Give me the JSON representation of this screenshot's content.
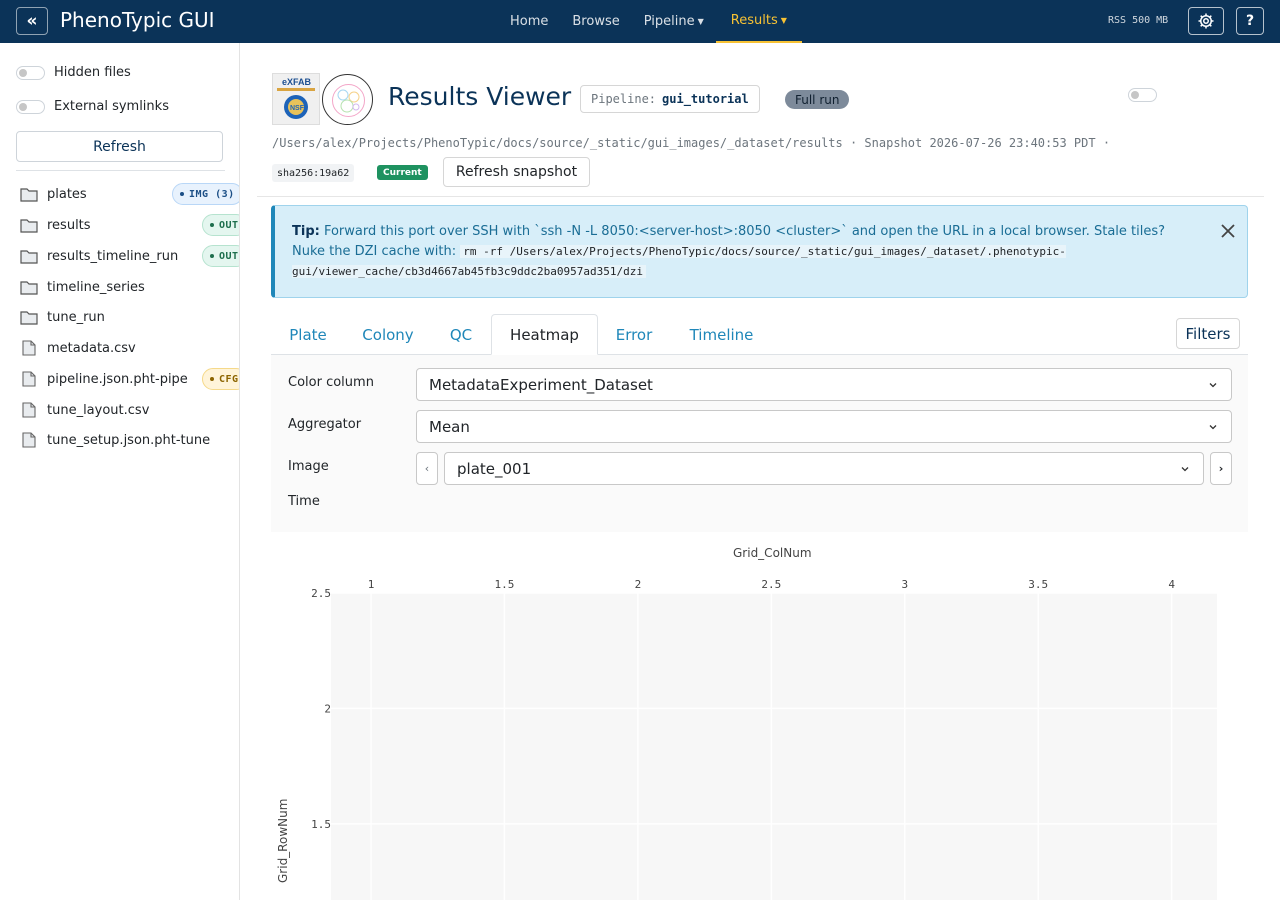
{
  "navbar": {
    "collapse_glyph": "«",
    "brand": "PhenoTypic GUI",
    "items": [
      {
        "label": "Home",
        "dropdown": false,
        "active": false
      },
      {
        "label": "Browse",
        "dropdown": false,
        "active": false
      },
      {
        "label": "Pipeline",
        "dropdown": true,
        "active": false
      },
      {
        "label": "Results",
        "dropdown": true,
        "active": true
      }
    ],
    "rss": "RSS 500 MB",
    "settings_icon": "gear-icon",
    "help_label": "?",
    "accent_color": "#f7c234",
    "bg_color": "#0b3358"
  },
  "sidebar": {
    "toggles": [
      {
        "label": "Hidden files",
        "on": false
      },
      {
        "label": "External symlinks",
        "on": false
      }
    ],
    "refresh_label": "Refresh",
    "items": [
      {
        "name": "plates",
        "type": "folder",
        "badge": "IMG (3)",
        "badge_kind": "img"
      },
      {
        "name": "results",
        "type": "folder",
        "badge": "OUT",
        "badge_kind": "out"
      },
      {
        "name": "results_timeline_run",
        "type": "folder",
        "badge": "OUT",
        "badge_kind": "out"
      },
      {
        "name": "timeline_series",
        "type": "folder",
        "badge": "",
        "badge_kind": ""
      },
      {
        "name": "tune_run",
        "type": "folder",
        "badge": "",
        "badge_kind": ""
      },
      {
        "name": "metadata.csv",
        "type": "file",
        "badge": "",
        "badge_kind": ""
      },
      {
        "name": "pipeline.json.pht-pipe",
        "type": "file",
        "badge": "CFG",
        "badge_kind": "cfg"
      },
      {
        "name": "tune_layout.csv",
        "type": "file",
        "badge": "",
        "badge_kind": ""
      },
      {
        "name": "tune_setup.json.pht-tune",
        "type": "file",
        "badge": "",
        "badge_kind": ""
      }
    ]
  },
  "header": {
    "title": "Results Viewer",
    "pipeline_key": "Pipeline:",
    "pipeline_value": "gui_tutorial",
    "run_badge": "Full run",
    "path_line": "/Users/alex/Projects/PhenoTypic/docs/source/_static/gui_images/_dataset/results · Snapshot 2026-07-26 23:40:53 PDT ·",
    "sha": "sha256:19a62",
    "current_label": "Current",
    "refresh_snapshot_label": "Refresh snapshot"
  },
  "tip": {
    "lead": "Tip:",
    "line1": "Forward this port over SSH with `ssh -N -L 8050:<server-host>:8050 <cluster>` and open the URL in a local browser. Stale tiles?",
    "line2_prefix": "Nuke the DZI cache with:",
    "code": "rm -rf /Users/alex/Projects/PhenoTypic/docs/source/_static/gui_images/_dataset/.phenotypic-gui/viewer_cache/cb3d4667ab45fb3c9ddc2ba0957ad351/dzi"
  },
  "tabs": [
    {
      "label": "Plate",
      "active": false
    },
    {
      "label": "Colony",
      "active": false
    },
    {
      "label": "QC",
      "active": false
    },
    {
      "label": "Heatmap",
      "active": true
    },
    {
      "label": "Error",
      "active": false
    },
    {
      "label": "Timeline",
      "active": false
    }
  ],
  "filters_label": "Filters",
  "controls": {
    "color_column_label": "Color column",
    "color_column_value": "MetadataExperiment_Dataset",
    "aggregator_label": "Aggregator",
    "aggregator_value": "Mean",
    "image_label": "Image",
    "image_value": "plate_001",
    "prev_glyph": "‹",
    "next_glyph": "›",
    "time_label": "Time"
  },
  "chart_data": {
    "type": "heatmap",
    "title": "",
    "xlabel": "Grid_ColNum",
    "ylabel": "Grid_RowNum",
    "xlim": [
      0.85,
      4.17
    ],
    "ylim": [
      2.5,
      1.17
    ],
    "x_ticks": [
      1,
      1.5,
      2,
      2.5,
      3,
      3.5,
      4
    ],
    "y_ticks": [
      2.5,
      2,
      1.5
    ],
    "x_axis_position": "top",
    "grid": true,
    "values": []
  }
}
